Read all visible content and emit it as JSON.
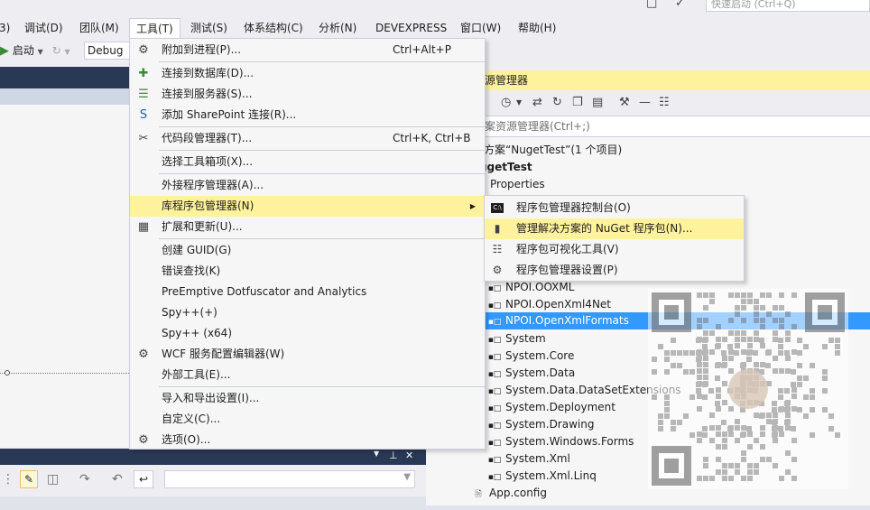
{
  "menubar": {
    "items": [
      "3)",
      "调试(D)",
      "团队(M)",
      "工具(T)",
      "测试(S)",
      "体系结构(C)",
      "分析(N)",
      "DEVEXPRESS",
      "窗口(W)",
      "帮助(H)"
    ],
    "quick_launch_placeholder": "快速启动 (Ctrl+Q)"
  },
  "toolbar": {
    "start_label": "启动",
    "config_value": "Debug"
  },
  "tools_menu": {
    "items": [
      {
        "icon": "attach-process-icon",
        "label": "附加到进程(P)...",
        "shortcut": "Ctrl+Alt+P"
      },
      {
        "icon": "connect-database-icon",
        "label": "连接到数据库(D)..."
      },
      {
        "icon": "connect-server-icon",
        "label": "连接到服务器(S)..."
      },
      {
        "icon": "sharepoint-icon",
        "label": "添加 SharePoint 连接(R)..."
      },
      {
        "icon": "code-snippet-icon",
        "label": "代码段管理器(T)...",
        "shortcut": "Ctrl+K, Ctrl+B"
      },
      {
        "label": "选择工具箱项(X)..."
      },
      {
        "label": "外接程序管理器(A)..."
      },
      {
        "label": "库程序包管理器(N)",
        "submenu": true
      },
      {
        "icon": "extensions-icon",
        "label": "扩展和更新(U)..."
      },
      {
        "label": "创建 GUID(G)"
      },
      {
        "label": "错误查找(K)"
      },
      {
        "label": "PreEmptive Dotfuscator and Analytics"
      },
      {
        "label": "Spy++(+)"
      },
      {
        "label": "Spy++ (x64)"
      },
      {
        "icon": "wcf-config-icon",
        "label": "WCF 服务配置编辑器(W)"
      },
      {
        "label": "外部工具(E)..."
      },
      {
        "label": "导入和导出设置(I)..."
      },
      {
        "label": "自定义(C)..."
      },
      {
        "icon": "gear-icon",
        "label": "选项(O)..."
      }
    ]
  },
  "package_submenu": {
    "items": [
      {
        "icon": "console-icon",
        "label": "程序包管理器控制台(O)"
      },
      {
        "icon": "nuget-package-icon",
        "label": "管理解决方案的 NuGet 程序包(N)..."
      },
      {
        "icon": "visualizer-icon",
        "label": "程序包可视化工具(V)"
      },
      {
        "icon": "gear-icon",
        "label": "程序包管理器设置(P)"
      }
    ]
  },
  "solution_explorer": {
    "title": "源管理器",
    "search_placeholder": "案资源管理器(Ctrl+;)",
    "tree": [
      "方案“NugetTest”(1 个项目)",
      "ugetTest",
      "Properties",
      "NPOI.OOXML",
      "NPOI.OpenXml4Net",
      "NPOI.OpenXmlFormats",
      "System",
      "System.Core",
      "System.Data",
      "System.Data.DataSetExtensions",
      "System.Deployment",
      "System.Drawing",
      "System.Windows.Forms",
      "System.Xml",
      "System.Xml.Linq",
      "App.config"
    ]
  },
  "colors": {
    "highlight": "#fff29d",
    "selection": "#3399ff",
    "dark_header": "#293955"
  }
}
